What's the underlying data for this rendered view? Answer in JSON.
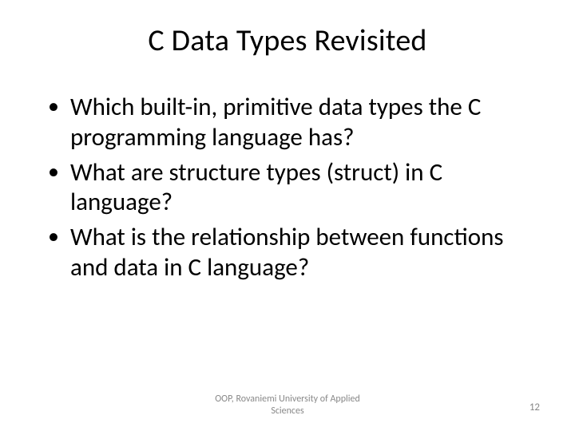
{
  "title": "C Data Types Revisited",
  "bullets": [
    "Which built-in, primitive data types the C programming language has?",
    "What are structure types (struct) in C language?",
    "What is the relationship between functions and data in C language?"
  ],
  "footer": "OOP, Rovaniemi University of Applied Sciences",
  "page_number": "12"
}
